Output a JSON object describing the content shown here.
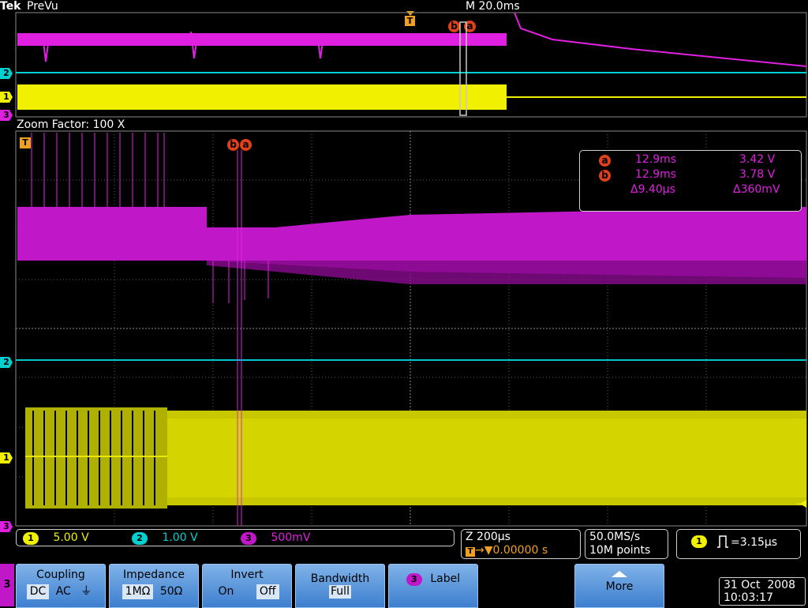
{
  "header": {
    "brand": "Tek",
    "mode": "PreVu",
    "timebase": "M 20.0ms",
    "trigger_marker": "T",
    "cursor_b": "b",
    "cursor_a": "a"
  },
  "zoom": {
    "label": "Zoom Factor: 100 X",
    "trigger_marker": "T"
  },
  "channel_markers": {
    "ch1": "1",
    "ch2": "2",
    "ch3": "3"
  },
  "cursor_readout": {
    "a_label": "a",
    "a_time": "12.9ms",
    "a_volt": "3.42 V",
    "b_label": "b",
    "b_time": "12.9ms",
    "b_volt": "3.78 V",
    "delta_time": "Δ9.40μs",
    "delta_volt": "Δ360mV"
  },
  "status": {
    "ch1_num": "1",
    "ch1_scale": "5.00 V",
    "ch2_num": "2",
    "ch2_scale": "1.00 V",
    "ch3_num": "3",
    "ch3_scale": "500mV",
    "zoom_scale": "Z 200μs",
    "trigger_pos_icon": "T",
    "trigger_pos": "→▼0.00000 s",
    "sample_rate": "50.0MS/s",
    "record_length": "10M points",
    "trig_ch": "1",
    "trig_readout": "=3.15μs"
  },
  "menu": {
    "side_channel": "3",
    "coupling_title": "Coupling",
    "coupling_dc": "DC",
    "coupling_ac": "AC",
    "coupling_gnd": "⏚",
    "impedance_title": "Impedance",
    "impedance_1m": "1MΩ",
    "impedance_50": "50Ω",
    "invert_title": "Invert",
    "invert_on": "On",
    "invert_off": "Off",
    "bandwidth_title": "Bandwidth",
    "bandwidth_value": "Full",
    "label_channel": "3",
    "label_title": "Label",
    "more_title": "More"
  },
  "datetime": {
    "date": "31 Oct  2008",
    "time": "10:03:17"
  },
  "colors": {
    "ch1": "#f0f000",
    "ch2": "#00d0d0",
    "ch3": "#e020e0",
    "cursor": "#e0401a",
    "trigger": "#f0a020",
    "button": "#5b97dc"
  }
}
